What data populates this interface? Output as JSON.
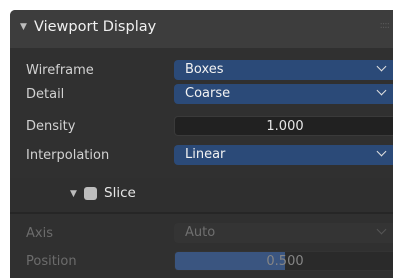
{
  "panel": {
    "title": "Viewport Display",
    "fields": {
      "wireframe": {
        "label": "Wireframe",
        "value": "Boxes"
      },
      "detail": {
        "label": "Detail",
        "value": "Coarse"
      },
      "density": {
        "label": "Density",
        "value": "1.000"
      },
      "interpolation": {
        "label": "Interpolation",
        "value": "Linear"
      }
    },
    "slice": {
      "label": "Slice",
      "checked": false,
      "axis": {
        "label": "Axis",
        "value": "Auto"
      },
      "position": {
        "label": "Position",
        "value": "0.500",
        "fraction": 0.5
      }
    }
  },
  "colors": {
    "accent": "#2b4a78",
    "panel_bg": "#303030",
    "header_bg": "#3d3d3d"
  }
}
